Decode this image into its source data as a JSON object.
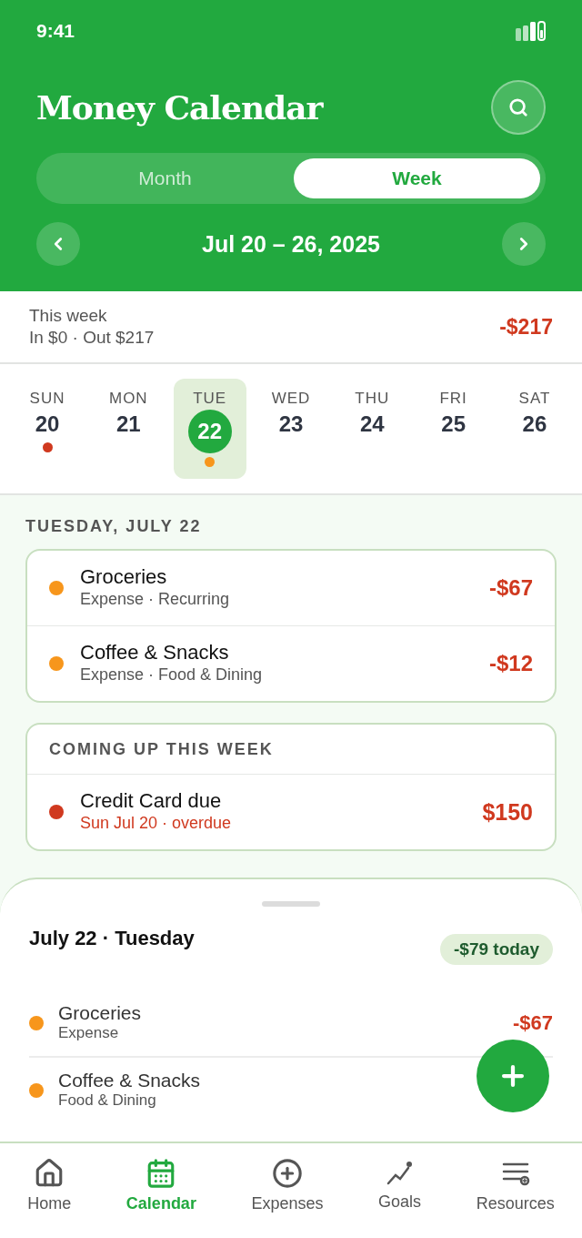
{
  "status_bar": {
    "time": "9:41"
  },
  "header": {
    "title": "Money Calendar"
  },
  "view_tabs": [
    {
      "label": "Month",
      "selected": false
    },
    {
      "label": "Week",
      "selected": true
    }
  ],
  "range": {
    "label": "Jul 20 – 26, 2025"
  },
  "summary": {
    "title": "This week",
    "detail": "In $0 · Out $217",
    "total": "-$217"
  },
  "days": [
    {
      "weekday": "SUN",
      "date": "20",
      "selected": false,
      "color": "#d0391f"
    },
    {
      "weekday": "MON",
      "date": "21",
      "selected": false
    },
    {
      "weekday": "TUE",
      "date": "22",
      "selected": true,
      "color": "#f7961c"
    },
    {
      "weekday": "WED",
      "date": "23",
      "selected": false
    },
    {
      "weekday": "THU",
      "date": "24",
      "selected": false
    },
    {
      "weekday": "FRI",
      "date": "25",
      "selected": false
    },
    {
      "weekday": "SAT",
      "date": "26",
      "selected": false
    }
  ],
  "day_heading": "TUESDAY, JULY 22",
  "transactions": [
    {
      "name": "Groceries",
      "detail": "Expense · Recurring",
      "amount": "-$67",
      "color": "#f7961c"
    },
    {
      "name": "Coffee & Snacks",
      "detail": "Expense · Food & Dining",
      "amount": "-$12",
      "color": "#f7961c"
    }
  ],
  "upcoming": {
    "title": "COMING UP THIS WEEK",
    "items": [
      {
        "name": "Credit Card due",
        "detail": "Sun Jul 20 · overdue",
        "amount": "$150",
        "color": "#d0391f",
        "overdue": true
      }
    ]
  },
  "sheet": {
    "title": "July 22 · Tuesday",
    "badge": "-$79 today",
    "items": [
      {
        "name": "Groceries",
        "detail": "Expense",
        "amount": "-$67",
        "color": "#f7961c"
      },
      {
        "name": "Coffee & Snacks",
        "detail": "Food & Dining",
        "color": "#f7961c"
      }
    ]
  },
  "nav": [
    {
      "label": "Home",
      "selected": false
    },
    {
      "label": "Calendar",
      "selected": true
    },
    {
      "label": "Expenses",
      "selected": false
    },
    {
      "label": "Goals",
      "selected": false
    },
    {
      "label": "Resources",
      "selected": false
    }
  ]
}
